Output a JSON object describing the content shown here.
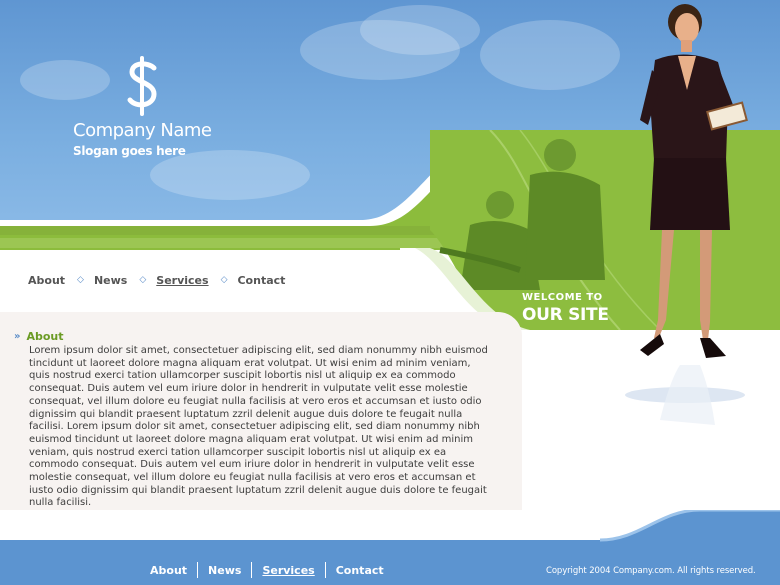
{
  "brand": {
    "company_name": "Company Name",
    "slogan": "Slogan goes here",
    "logo_icon": "dollar-s-logo"
  },
  "hero": {
    "welcome_small": "WELCOME TO",
    "welcome_big": "OUR SITE"
  },
  "top_nav": {
    "items": [
      {
        "label": "About"
      },
      {
        "label": "News"
      },
      {
        "label": "Services",
        "active": true
      },
      {
        "label": "Contact"
      }
    ],
    "separator_icon": "diamond-icon"
  },
  "content": {
    "heading": "About",
    "heading_icon": "double-chevron-right-icon",
    "body": "Lorem ipsum dolor sit amet, consectetuer adipiscing elit, sed diam nonummy nibh euismod tincidunt ut laoreet dolore magna aliquam erat volutpat. Ut wisi enim ad minim veniam, quis nostrud exerci tation ullamcorper suscipit lobortis nisl ut aliquip ex ea commodo consequat. Duis autem vel eum iriure dolor in hendrerit in vulputate velit esse molestie consequat, vel illum dolore eu feugiat nulla facilisis at vero eros et accumsan et iusto odio dignissim qui blandit praesent luptatum zzril delenit augue duis dolore te feugait nulla facilisi. Lorem ipsum dolor sit amet, consectetuer adipiscing elit, sed diam nonummy nibh euismod tincidunt ut laoreet dolore magna aliquam erat volutpat. Ut wisi enim ad minim veniam, quis nostrud exerci tation ullamcorper suscipit lobortis nisl ut aliquip ex ea commodo consequat. Duis autem vel eum iriure dolor in hendrerit in vulputate velit esse molestie consequat, vel illum dolore eu feugiat nulla facilisis at vero eros et accumsan et iusto odio dignissim qui blandit praesent luptatum zzril delenit augue duis dolore te feugait nulla facilisi."
  },
  "footer": {
    "nav": [
      {
        "label": "About"
      },
      {
        "label": "News"
      },
      {
        "label": "Services",
        "active": true
      },
      {
        "label": "Contact"
      }
    ],
    "copyright": "Copyright 2004 Company.com. All rights reserved."
  },
  "colors": {
    "sky_blue": "#6ea4dc",
    "green": "#8cbc3c",
    "footer_blue": "#5c94d0",
    "heading_green": "#6b9b24",
    "content_bg": "#f7f3f1"
  }
}
